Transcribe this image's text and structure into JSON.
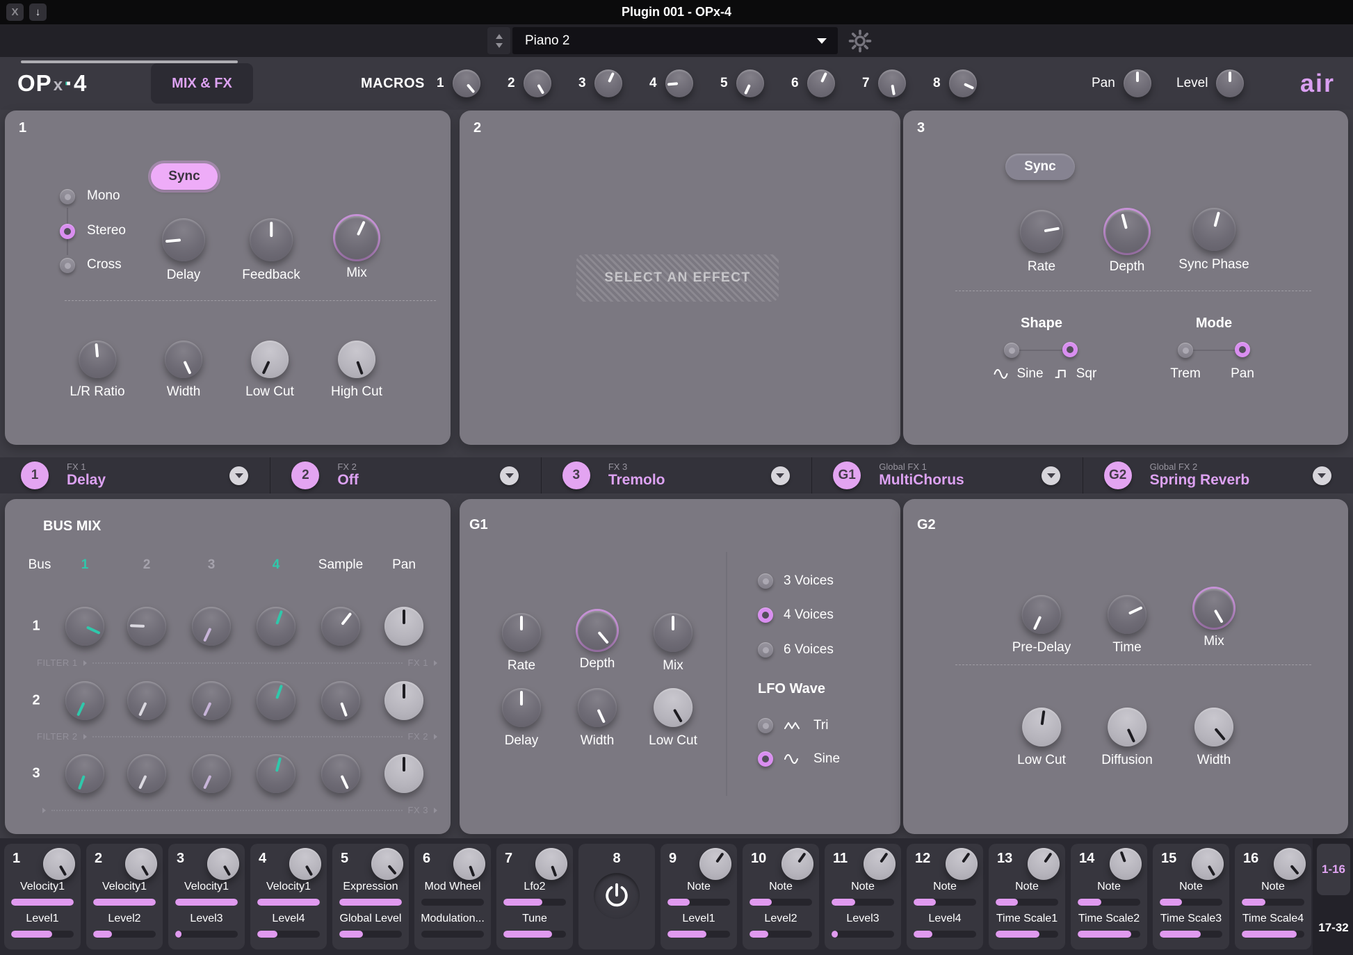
{
  "titlebar": {
    "title": "Plugin 001 - OPx-4",
    "close_label": "X",
    "download_label": "↓"
  },
  "preset_bar": {
    "preset_name": "Piano 2"
  },
  "header": {
    "logo": {
      "part1": "OP",
      "part2": "x",
      "part3": "·4"
    },
    "page_button": "MIX & FX",
    "macros_label": "MACROS",
    "macros": [
      {
        "num": "1",
        "angle": 140
      },
      {
        "num": "2",
        "angle": 150
      },
      {
        "num": "3",
        "angle": 25
      },
      {
        "num": "4",
        "angle": 265
      },
      {
        "num": "5",
        "angle": 205
      },
      {
        "num": "6",
        "angle": 25
      },
      {
        "num": "7",
        "angle": 170
      },
      {
        "num": "8",
        "angle": 115
      }
    ],
    "pan_label": "Pan",
    "pan_angle": 0,
    "level_label": "Level",
    "level_angle": 0,
    "brand": "air"
  },
  "fx1_panel": {
    "index": "1",
    "sync_button": "Sync",
    "channel_modes": [
      {
        "label": "Mono",
        "selected": false
      },
      {
        "label": "Stereo",
        "selected": true
      },
      {
        "label": "Cross",
        "selected": false
      }
    ],
    "knobs_row1": [
      {
        "label": "Delay",
        "angle": 265
      },
      {
        "label": "Feedback",
        "angle": 0
      },
      {
        "label": "Mix",
        "angle": 25,
        "ring": true
      }
    ],
    "knobs_row2": [
      {
        "label": "L/R Ratio",
        "angle": 355
      },
      {
        "label": "Width",
        "angle": 155
      },
      {
        "label": "Low Cut",
        "angle": 205,
        "light": true
      },
      {
        "label": "High Cut",
        "angle": 160,
        "light": true
      }
    ]
  },
  "fx2_panel": {
    "index": "2",
    "placeholder": "SELECT AN EFFECT"
  },
  "fx3_panel": {
    "index": "3",
    "sync_button": "Sync",
    "knobs": [
      {
        "label": "Rate",
        "angle": 80
      },
      {
        "label": "Depth",
        "angle": 345,
        "ring": true
      },
      {
        "label": "Sync Phase",
        "angle": 15
      }
    ],
    "shape": {
      "title": "Shape",
      "options": [
        {
          "label": "Sine",
          "icon": "sine-wave-icon",
          "selected": false
        },
        {
          "label": "Sqr",
          "icon": "square-wave-icon",
          "selected": true
        }
      ]
    },
    "mode": {
      "title": "Mode",
      "options": [
        {
          "label": "Trem",
          "selected": false
        },
        {
          "label": "Pan",
          "selected": true
        }
      ]
    }
  },
  "fx_tabs": [
    {
      "badge": "1",
      "slot": "FX 1",
      "name": "Delay"
    },
    {
      "badge": "2",
      "slot": "FX 2",
      "name": "Off"
    },
    {
      "badge": "3",
      "slot": "FX 3",
      "name": "Tremolo"
    },
    {
      "badge": "G1",
      "slot": "Global FX 1",
      "name": "MultiChorus"
    },
    {
      "badge": "G2",
      "slot": "Global FX 2",
      "name": "Spring Reverb"
    }
  ],
  "bus_mix": {
    "title": "BUS MIX",
    "header": {
      "bus": "Bus",
      "cols": [
        {
          "label": "1",
          "accent": true
        },
        {
          "label": "2",
          "accent": false
        },
        {
          "label": "3",
          "accent": false
        },
        {
          "label": "4",
          "accent": true
        }
      ],
      "sample": "Sample",
      "pan": "Pan"
    },
    "rows": [
      {
        "label": "1",
        "knobs": [
          {
            "angle": 115,
            "color": "teal"
          },
          {
            "angle": 272,
            "color": "gray"
          },
          {
            "angle": 205,
            "color": "lav"
          },
          {
            "angle": 20,
            "color": "teal"
          },
          {
            "angle": 38,
            "color": "white"
          },
          {
            "angle": 0,
            "color": "black",
            "light": true
          }
        ]
      },
      {
        "label": "2",
        "knobs": [
          {
            "angle": 205,
            "color": "teal"
          },
          {
            "angle": 205,
            "color": "gray"
          },
          {
            "angle": 205,
            "color": "lav"
          },
          {
            "angle": 20,
            "color": "teal"
          },
          {
            "angle": 160,
            "color": "white"
          },
          {
            "angle": 0,
            "color": "black",
            "light": true
          }
        ]
      },
      {
        "label": "3",
        "knobs": [
          {
            "angle": 200,
            "color": "teal"
          },
          {
            "angle": 205,
            "color": "gray"
          },
          {
            "angle": 205,
            "color": "lav"
          },
          {
            "angle": 15,
            "color": "teal"
          },
          {
            "angle": 155,
            "color": "white"
          },
          {
            "angle": 0,
            "color": "black",
            "light": true
          }
        ]
      }
    ],
    "separators": [
      {
        "left": "FILTER 1",
        "right": "FX 1"
      },
      {
        "left": "FILTER 2",
        "right": "FX 2"
      },
      {
        "left": "",
        "right": "FX 3"
      }
    ]
  },
  "g1_panel": {
    "index": "G1",
    "knobs_row1": [
      {
        "label": "Rate",
        "angle": 0
      },
      {
        "label": "Depth",
        "angle": 140,
        "ring": true
      },
      {
        "label": "Mix",
        "angle": 0
      }
    ],
    "knobs_row2": [
      {
        "label": "Delay",
        "angle": 0
      },
      {
        "label": "Width",
        "angle": 155
      },
      {
        "label": "Low Cut",
        "angle": 150,
        "light": true
      }
    ],
    "voices": [
      {
        "label": "3 Voices",
        "selected": false
      },
      {
        "label": "4 Voices",
        "selected": true
      },
      {
        "label": "6 Voices",
        "selected": false
      }
    ],
    "lfo_title": "LFO Wave",
    "lfo_options": [
      {
        "label": "Tri",
        "icon": "triangle-wave-icon",
        "selected": false
      },
      {
        "label": "Sine",
        "icon": "sine-wave-icon",
        "selected": true
      }
    ]
  },
  "g2_panel": {
    "index": "G2",
    "knobs_row1": [
      {
        "label": "Pre-Delay",
        "angle": 205
      },
      {
        "label": "Time",
        "angle": 65
      },
      {
        "label": "Mix",
        "angle": 150,
        "ring": true
      }
    ],
    "knobs_row2": [
      {
        "label": "Low Cut",
        "angle": 8,
        "light": true
      },
      {
        "label": "Diffusion",
        "angle": 155,
        "light": true
      },
      {
        "label": "Width",
        "angle": 140,
        "light": true
      }
    ]
  },
  "macro_strip": {
    "slots": [
      {
        "num": "1",
        "knob_angle": 150,
        "rows": [
          {
            "label": "Velocity1",
            "value": 100
          },
          {
            "label": "Level1",
            "value": 65
          }
        ]
      },
      {
        "num": "2",
        "knob_angle": 150,
        "rows": [
          {
            "label": "Velocity1",
            "value": 100
          },
          {
            "label": "Level2",
            "value": 30
          }
        ]
      },
      {
        "num": "3",
        "knob_angle": 150,
        "rows": [
          {
            "label": "Velocity1",
            "value": 100
          },
          {
            "label": "Level3",
            "value": 10
          }
        ]
      },
      {
        "num": "4",
        "knob_angle": 150,
        "rows": [
          {
            "label": "Velocity1",
            "value": 100
          },
          {
            "label": "Level4",
            "value": 32
          }
        ]
      },
      {
        "num": "5",
        "knob_angle": 140,
        "rows": [
          {
            "label": "Expression",
            "value": 100
          },
          {
            "label": "Global Level",
            "value": 38
          }
        ]
      },
      {
        "num": "6",
        "knob_angle": 160,
        "rows": [
          {
            "label": "Mod Wheel",
            "value": 0
          },
          {
            "label": "Modulation...",
            "value": 0
          }
        ]
      },
      {
        "num": "7",
        "knob_angle": 160,
        "rows": [
          {
            "label": "Lfo2",
            "value": 62
          },
          {
            "label": "Tune",
            "value": 78
          }
        ]
      },
      {
        "num": "8",
        "power": true,
        "rows": []
      },
      {
        "num": "9",
        "knob_angle": 35,
        "rows": [
          {
            "label": "Note",
            "value": 36
          },
          {
            "label": "Level1",
            "value": 62
          }
        ]
      },
      {
        "num": "10",
        "knob_angle": 35,
        "rows": [
          {
            "label": "Note",
            "value": 36
          },
          {
            "label": "Level2",
            "value": 30
          }
        ]
      },
      {
        "num": "11",
        "knob_angle": 35,
        "rows": [
          {
            "label": "Note",
            "value": 38
          },
          {
            "label": "Level3",
            "value": 10
          }
        ]
      },
      {
        "num": "12",
        "knob_angle": 35,
        "rows": [
          {
            "label": "Note",
            "value": 36
          },
          {
            "label": "Level4",
            "value": 30
          }
        ]
      },
      {
        "num": "13",
        "knob_angle": 35,
        "rows": [
          {
            "label": "Note",
            "value": 36
          },
          {
            "label": "Time Scale1",
            "value": 70
          }
        ]
      },
      {
        "num": "14",
        "knob_angle": 340,
        "rows": [
          {
            "label": "Note",
            "value": 38
          },
          {
            "label": "Time Scale2",
            "value": 85
          }
        ]
      },
      {
        "num": "15",
        "knob_angle": 150,
        "rows": [
          {
            "label": "Note",
            "value": 36
          },
          {
            "label": "Time Scale3",
            "value": 65
          }
        ]
      },
      {
        "num": "16",
        "knob_angle": 140,
        "rows": [
          {
            "label": "Note",
            "value": 38
          },
          {
            "label": "Time Scale4",
            "value": 88
          }
        ]
      }
    ],
    "page_tabs": [
      {
        "label": "1-16",
        "active": true
      },
      {
        "label": "17-32",
        "active": false
      }
    ]
  },
  "colors": {
    "accent_pink": "#e0a1f0",
    "accent_teal": "#2fc8ab",
    "panel_bg": "#7b7881",
    "bar_fill": "#e09aef"
  }
}
